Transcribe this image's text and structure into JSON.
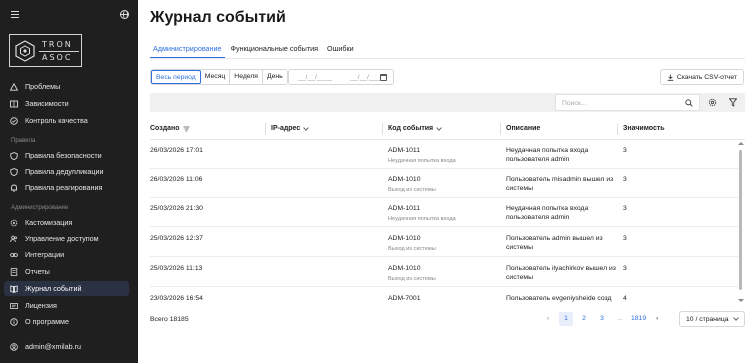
{
  "sidebar": {
    "logo": {
      "line1": "TRON",
      "line2": "ASOC"
    },
    "groups": [
      {
        "section": "",
        "items": [
          {
            "label": "Проблемы",
            "icon": "alert-triangle-icon"
          },
          {
            "label": "Зависимости",
            "icon": "book-icon"
          },
          {
            "label": "Контроль качества",
            "icon": "shield-check-icon"
          }
        ]
      },
      {
        "section": "Правила",
        "items": [
          {
            "label": "Правила безопасности",
            "icon": "shield-icon"
          },
          {
            "label": "Правила дедупликации",
            "icon": "shield-icon"
          },
          {
            "label": "Правила реагирования",
            "icon": "bell-icon"
          }
        ]
      },
      {
        "section": "Администрирование",
        "items": [
          {
            "label": "Кастомизация",
            "icon": "settings-icon"
          },
          {
            "label": "Управление доступом",
            "icon": "users-icon"
          },
          {
            "label": "Интеграции",
            "icon": "link-icon"
          },
          {
            "label": "Отчеты",
            "icon": "report-icon"
          },
          {
            "label": "Журнал событий",
            "icon": "journal-icon",
            "active": true
          },
          {
            "label": "Лицензия",
            "icon": "license-icon"
          },
          {
            "label": "О программе",
            "icon": "info-icon"
          }
        ]
      }
    ],
    "user": "admin@xmilab.ru"
  },
  "page": {
    "title": "Журнал событий"
  },
  "tabs": [
    {
      "label": "Администрирование",
      "active": true
    },
    {
      "label": "Функциональные события"
    },
    {
      "label": "Ошибки"
    }
  ],
  "period": [
    "Весь период",
    "Месяц",
    "Неделя",
    "День"
  ],
  "daterange": {
    "from_placeholder": "__/__/____",
    "to_placeholder": "__/__/____"
  },
  "export_label": "Скачать CSV-отчет",
  "search": {
    "placeholder": "Поиск..."
  },
  "table": {
    "columns": [
      "Создано",
      "IP-адрес",
      "Код события",
      "Описание",
      "Значимость"
    ],
    "rows": [
      {
        "created": "26/03/2026 17:01",
        "code": "ADM-1011",
        "code_desc": "Неудачная попытка входа",
        "description": "Неудачная попытка входа пользователя admin",
        "severity": "3"
      },
      {
        "created": "26/03/2026 11:06",
        "code": "ADM-1010",
        "code_desc": "Выход из системы",
        "description": "Пользователь misadmin вышел из системы",
        "severity": "3"
      },
      {
        "created": "25/03/2026 21:30",
        "code": "ADM-1011",
        "code_desc": "Неудачная попытка входа",
        "description": "Неудачная попытка входа пользователя admin",
        "severity": "3"
      },
      {
        "created": "25/03/2026 12:37",
        "code": "ADM-1010",
        "code_desc": "Выход из системы",
        "description": "Пользователь admin вышел из системы",
        "severity": "3"
      },
      {
        "created": "25/03/2026 11:13",
        "code": "ADM-1010",
        "code_desc": "Выход из системы",
        "description": "Пользователь ilyachirkov вышел из системы",
        "severity": "3"
      },
      {
        "created": "23/03/2026 16:54",
        "code": "ADM-7001",
        "code_desc": "",
        "description": "Пользователь evgeniysheide созд",
        "severity": "4"
      }
    ]
  },
  "footer": {
    "total": "Всего 18185",
    "pages": [
      "1",
      "2",
      "3",
      "...",
      "1819"
    ],
    "current_page": "1",
    "page_size": "10 / страница"
  }
}
